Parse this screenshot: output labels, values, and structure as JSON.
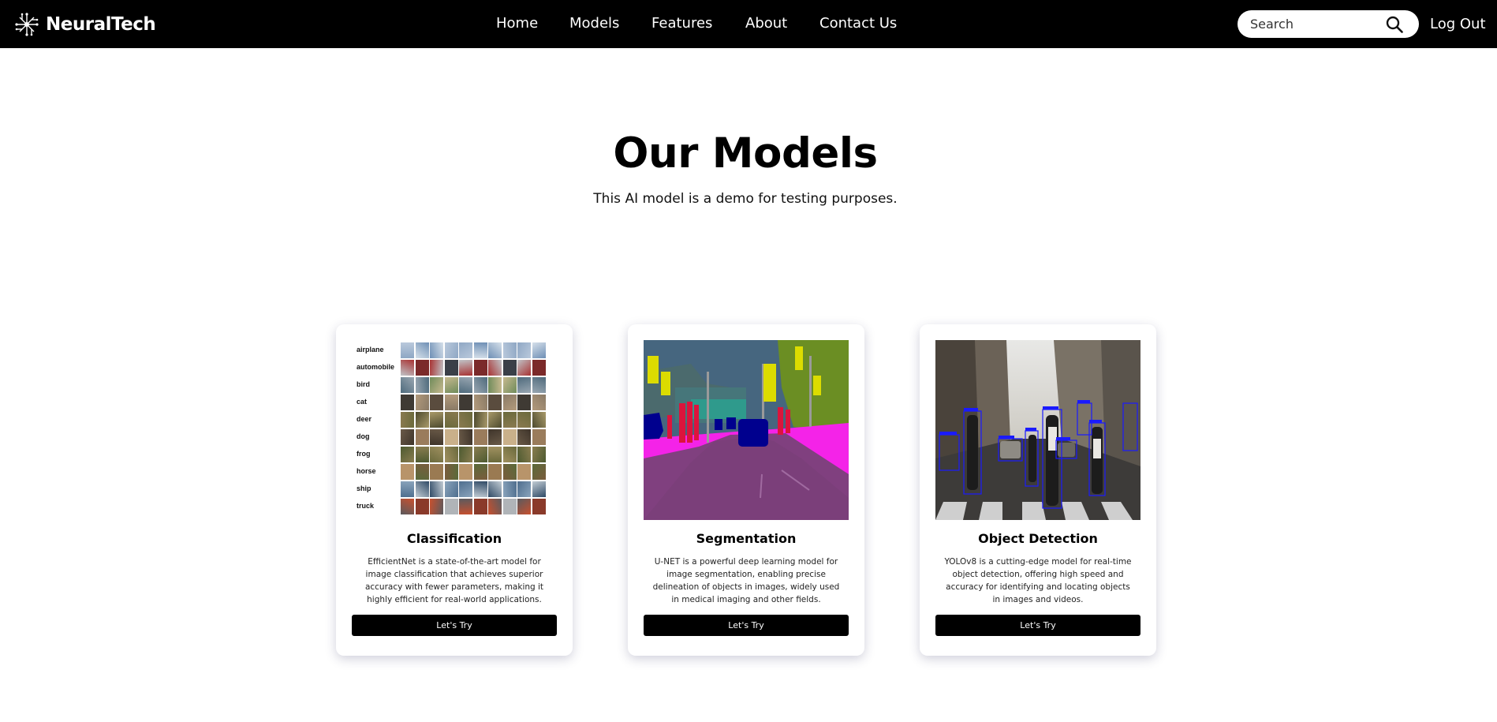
{
  "brand": {
    "name": "NeuralTech",
    "icon": "neural-network-icon"
  },
  "nav": {
    "links": [
      {
        "label": "Home"
      },
      {
        "label": "Models"
      },
      {
        "label": "Features"
      },
      {
        "label": "About"
      },
      {
        "label": "Contact Us"
      }
    ],
    "search_placeholder": "Search",
    "search_icon": "search-icon",
    "logout_label": "Log Out"
  },
  "hero": {
    "title": "Our Models",
    "subtitle": "This AI model is a demo for testing purposes."
  },
  "cards": [
    {
      "title": "Classification",
      "description": "EfficientNet is a state-of-the-art model for image classification that achieves superior accuracy with fewer parameters, making it highly efficient for real-world applications.",
      "button_label": "Let's Try",
      "image": {
        "labels": [
          "airplane",
          "automobile",
          "bird",
          "cat",
          "deer",
          "dog",
          "frog",
          "horse",
          "ship",
          "truck"
        ]
      }
    },
    {
      "title": "Segmentation",
      "description": "U-NET is a powerful deep learning model for image segmentation, enabling precise delineation of objects in images, widely used in medical imaging and other fields.",
      "button_label": "Let's Try"
    },
    {
      "title": "Object Detection",
      "description": "YOLOv8 is a cutting-edge model for real-time object detection, offering high speed and accuracy for identifying and locating objects in images and videos.",
      "button_label": "Let's Try"
    }
  ],
  "colors": {
    "navbar_bg": "#000000",
    "page_bg": "#ffffff",
    "button_bg": "#000000",
    "segmentation_road": "#80407f",
    "segmentation_sidewalk": "#f423e8",
    "segmentation_vehicle": "#00008e",
    "segmentation_person": "#dc143c",
    "segmentation_sign": "#dcdc00",
    "segmentation_vegetation": "#6b8e23",
    "detection_box": "#1a1aff"
  }
}
